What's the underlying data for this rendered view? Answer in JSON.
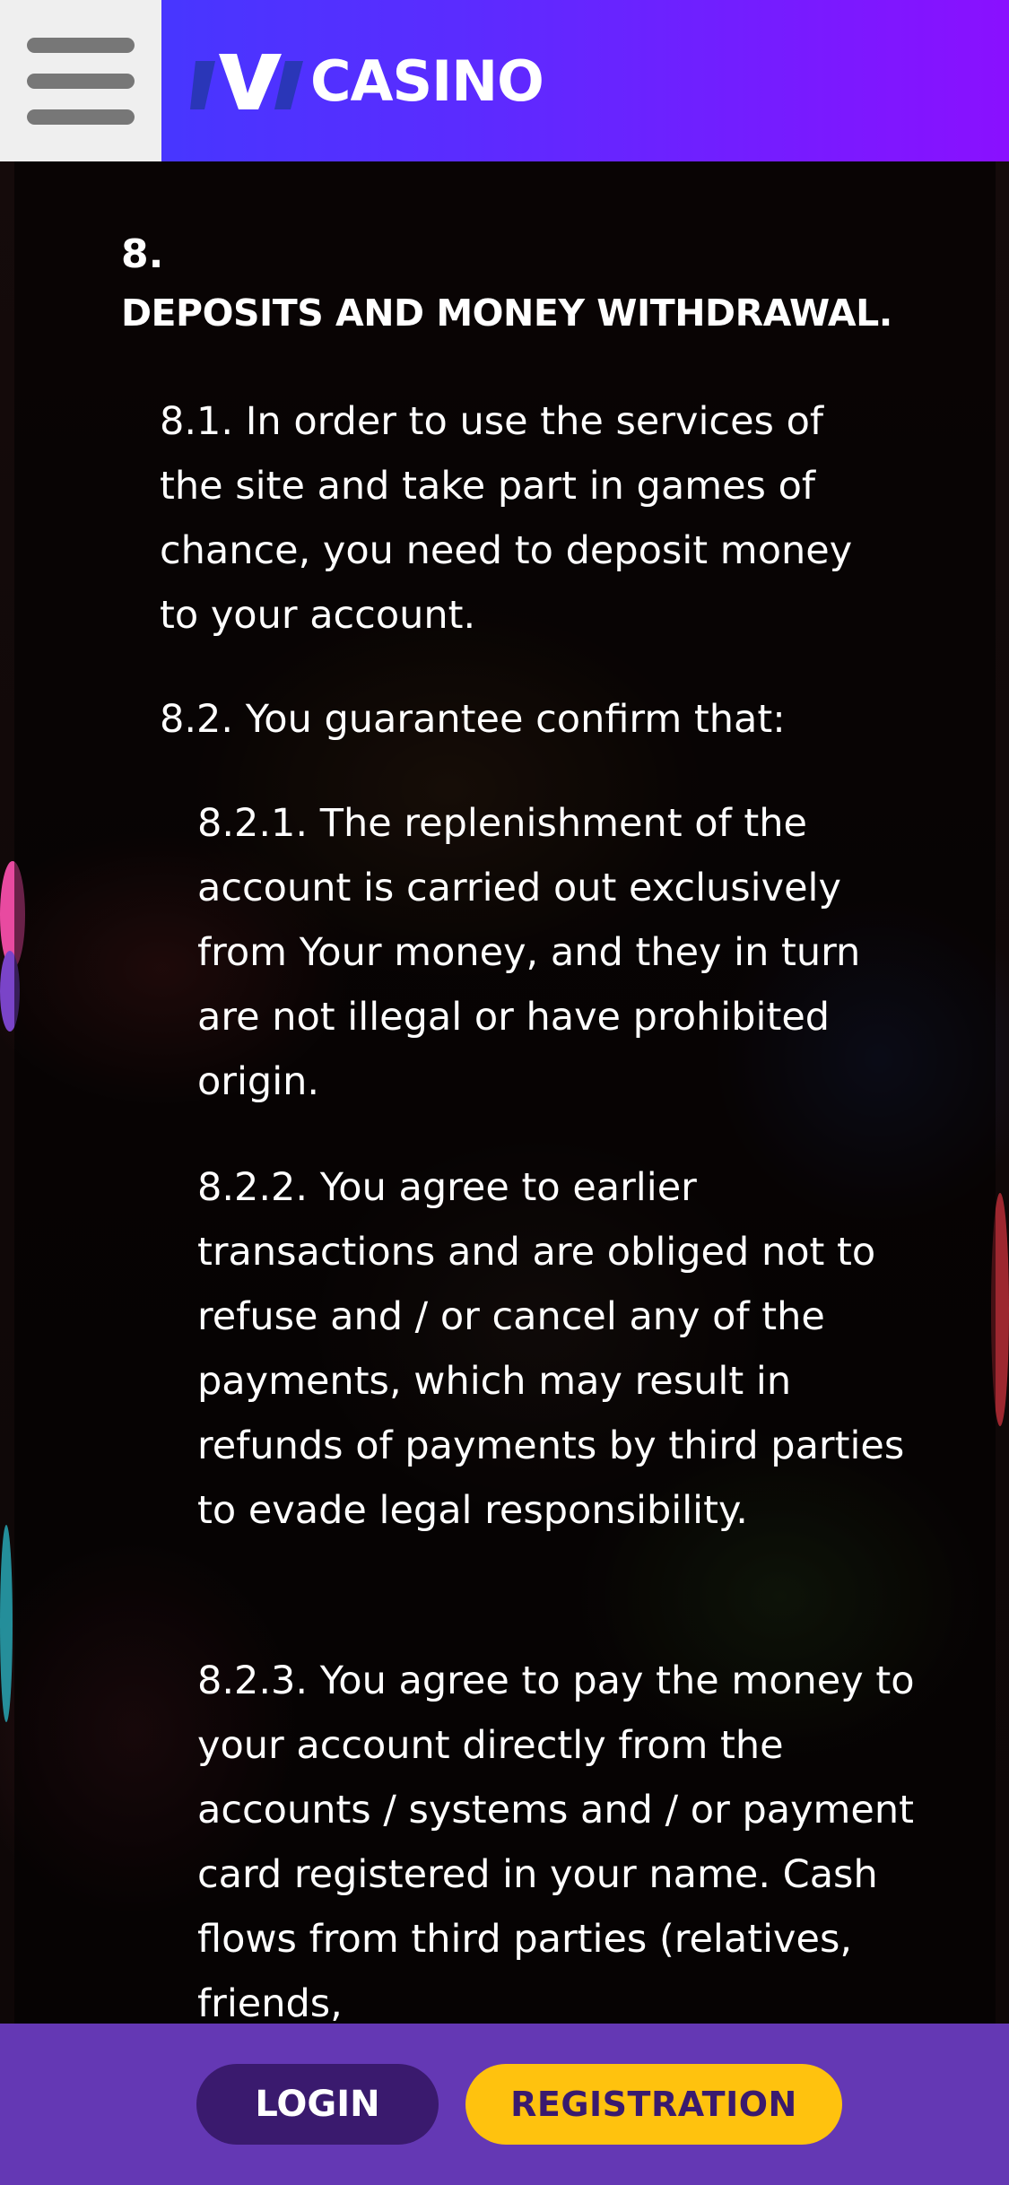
{
  "header": {
    "menu_icon": "hamburger-menu-icon",
    "logo_icon": "ivi-logo-icon",
    "logo_text": "CASINO",
    "gradient_start": "#3d3cff",
    "gradient_end": "#8a10ff"
  },
  "section": {
    "number": "8.",
    "title": "DEPOSITS AND MONEY WITHDRAWAL.",
    "paragraphs": [
      "8.1. In order to use the services of the site and take part in games of chance, you need to deposit money to your account.",
      "8.2. You guarantee confirm that:",
      "8.2.1. The replenishment of the account is carried out exclusively from Your money, and they in turn are not illegal or have prohibited origin.",
      "8.2.2. You agree to earlier transactions and are obliged not to refuse and / or cancel any of the payments, which may result in refunds of payments by third parties to evade legal responsibility.",
      "8.2.3. You agree to pay the money to your account directly from the accounts / systems and / or payment card registered in your name. Cash flows from third parties (relatives, friends,"
    ]
  },
  "bottom_bar": {
    "login_label": "LOGIN",
    "registration_label": "REGISTRATION",
    "login_color": "#3a1a6e",
    "registration_color": "#ffc20e",
    "bar_color": "#6438b4"
  }
}
